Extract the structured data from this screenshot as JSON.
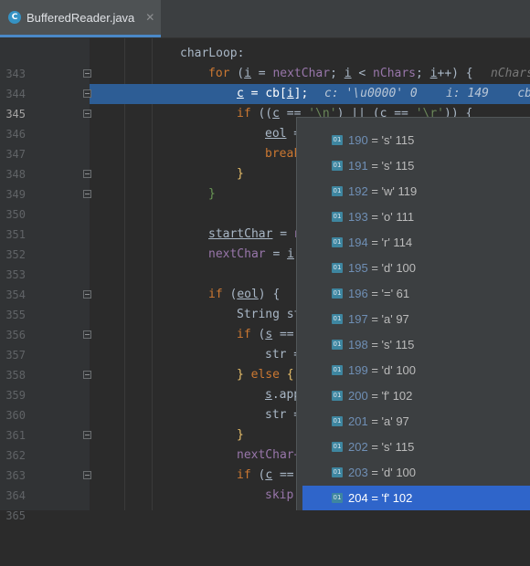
{
  "tab": {
    "icon_letter": "C",
    "title": "BufferedReader.java",
    "close": "✕"
  },
  "lines": [
    {
      "n": "343"
    },
    {
      "n": "344"
    },
    {
      "n": "345"
    },
    {
      "n": "346"
    },
    {
      "n": "347"
    },
    {
      "n": "348"
    },
    {
      "n": "349"
    },
    {
      "n": "350"
    },
    {
      "n": "351"
    },
    {
      "n": "352"
    },
    {
      "n": "353"
    },
    {
      "n": "354"
    },
    {
      "n": "355"
    },
    {
      "n": "356"
    },
    {
      "n": "357"
    },
    {
      "n": "358"
    },
    {
      "n": "359"
    },
    {
      "n": "360"
    },
    {
      "n": "361"
    },
    {
      "n": "362"
    },
    {
      "n": "363"
    },
    {
      "n": "364"
    },
    {
      "n": "365"
    }
  ],
  "code": {
    "l343": "charLoop:",
    "l344_for": "for",
    "l344_a": " (",
    "l344_i": "i",
    "l344_b": " = ",
    "l344_nextChar": "nextChar",
    "l344_c": "; ",
    "l344_i2": "i",
    "l344_d": " < ",
    "l344_nChars": "nChars",
    "l344_e": "; ",
    "l344_i3": "i",
    "l344_f": "++) {",
    "l344_hint": "nChars",
    "l345_c": "c",
    "l345_a": " = ",
    "l345_cb": "cb",
    "l345_b": "[",
    "l345_i": "i",
    "l345_d": "];",
    "l345_hint": "c: '\\u0000' 0    i: 149    cb",
    "l346_if": "if",
    "l346_a": " ((",
    "l346_c": "c",
    "l346_b": " == ",
    "l346_s1": "'\\n'",
    "l346_d": ") || (",
    "l346_c2": "c",
    "l346_e": " == ",
    "l346_s2": "'\\r'",
    "l346_f": ")) {",
    "l347": "eol",
    "l347_b": " =",
    "l348": "break",
    "l349": "}",
    "l350": "}",
    "l352": "startChar",
    "l352_b": " = ",
    "l352_c": "n",
    "l353": "nextChar",
    "l353_b": " = ",
    "l353_c": "i",
    "l355_if": "if",
    "l355_a": " (",
    "l355_eol": "eol",
    "l355_b": ") {",
    "l356": "String st",
    "l357_if": "if",
    "l357_a": " (",
    "l357_s": "s",
    "l357_b": " ==",
    "l358": "str =",
    "l359_a": "} ",
    "l359_else": "else",
    "l359_b": " {",
    "l360_s": "s",
    "l360_b": ".app",
    "l361": "str =",
    "l362": "}",
    "l363": "nextChar+",
    "l364_if": "if",
    "l364_a": " (",
    "l364_c": "c",
    "l364_b": " ==",
    "l365": "skip"
  },
  "popup": {
    "badge": "01",
    "items": [
      {
        "idx": "190",
        "val": " = 's' 115"
      },
      {
        "idx": "191",
        "val": " = 's' 115"
      },
      {
        "idx": "192",
        "val": " = 'w' 119"
      },
      {
        "idx": "193",
        "val": " = 'o' 111"
      },
      {
        "idx": "194",
        "val": " = 'r' 114"
      },
      {
        "idx": "195",
        "val": " = 'd' 100"
      },
      {
        "idx": "196",
        "val": " = '=' 61"
      },
      {
        "idx": "197",
        "val": " = 'a' 97"
      },
      {
        "idx": "198",
        "val": " = 's' 115"
      },
      {
        "idx": "199",
        "val": " = 'd' 100"
      },
      {
        "idx": "200",
        "val": " = 'f' 102"
      },
      {
        "idx": "201",
        "val": " = 'a' 97"
      },
      {
        "idx": "202",
        "val": " = 's' 115"
      },
      {
        "idx": "203",
        "val": " = 'd' 100"
      },
      {
        "idx": "204",
        "val": " = 'f' 102"
      }
    ],
    "selected_index": 14
  },
  "colors": {
    "editor_bg": "#2b2b2b",
    "keyword": "#cc7832",
    "field": "#9876aa",
    "string": "#6a8759",
    "selection": "#2d5d95",
    "popup_selection": "#2f65ca"
  }
}
